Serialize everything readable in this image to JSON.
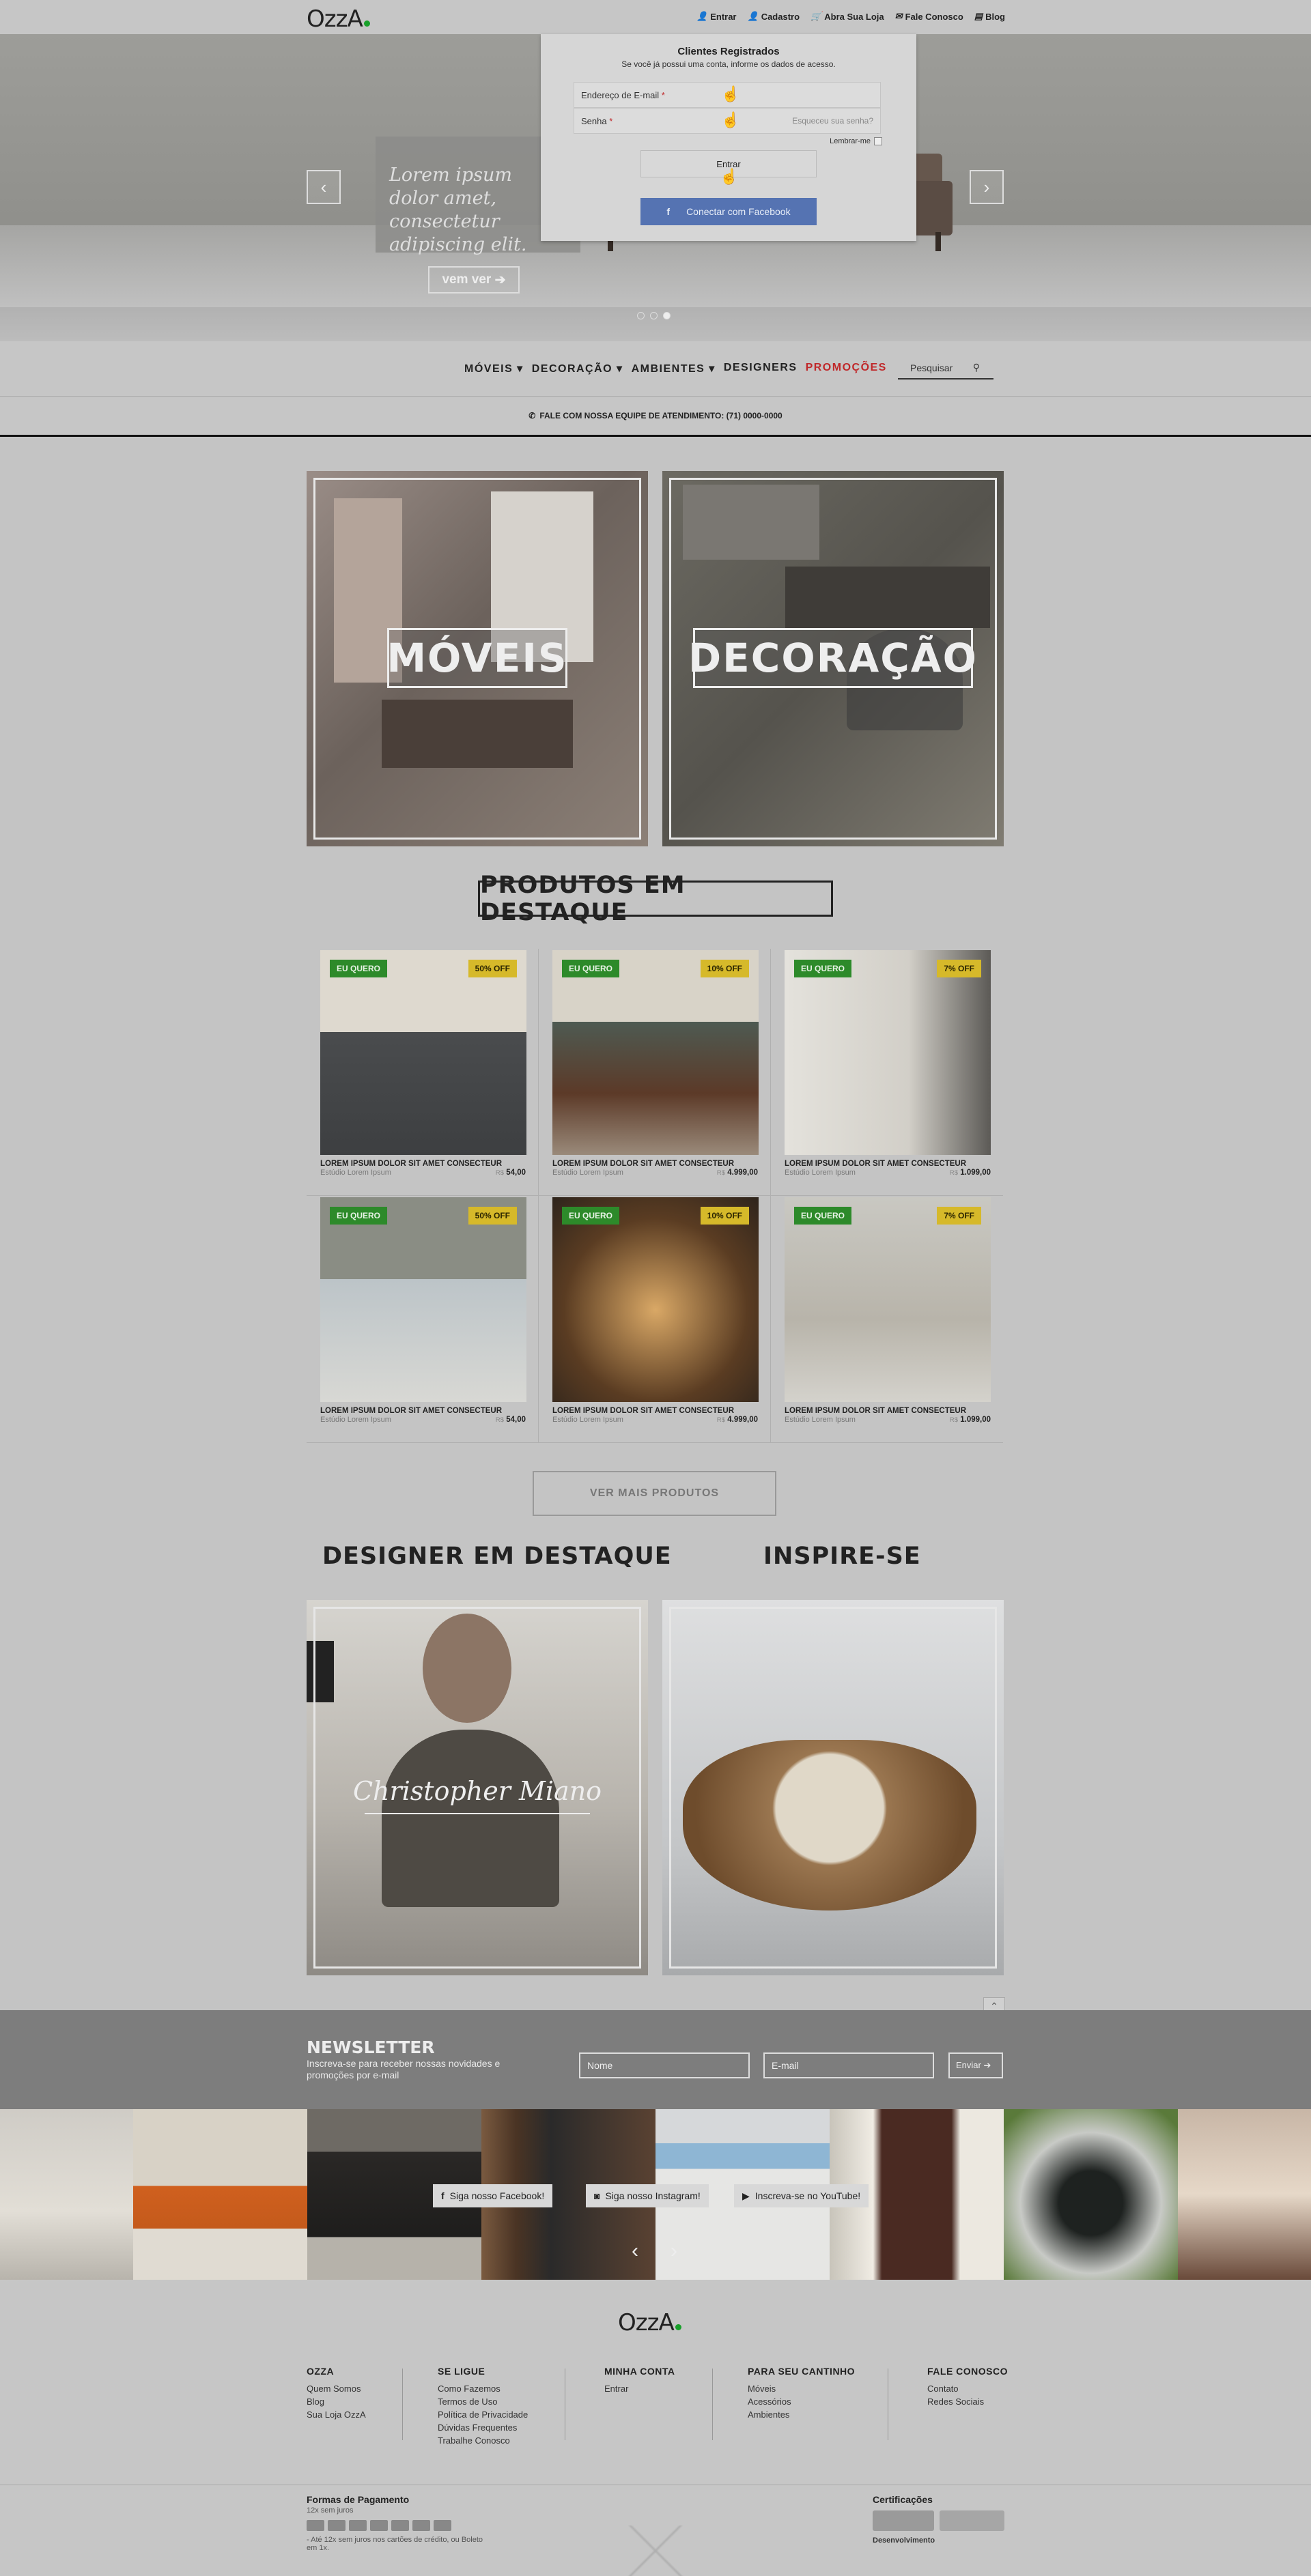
{
  "header": {
    "logo": "OzzA",
    "links": [
      "Entrar",
      "Cadastro",
      "Abra Sua Loja",
      "Fale Conosco",
      "Blog"
    ]
  },
  "hero": {
    "text": "Lorem ipsum dolor amet, consectetur adipiscing elit.",
    "button": "vem ver",
    "prev": "‹",
    "next": "›"
  },
  "login": {
    "title": "Clientes Registrados",
    "subtitle": "Se você já possui uma conta, informe os dados de acesso.",
    "email_label": "Endereço de E-mail",
    "password_label": "Senha",
    "required": "*",
    "forgot": "Esqueceu sua senha?",
    "remember": "Lembrar-me",
    "submit": "Entrar",
    "facebook": "Conectar com Facebook",
    "fb_icon": "f"
  },
  "nav": {
    "items": [
      "MÓVEIS",
      "DECORAÇÃO",
      "AMBIENTES",
      "DESIGNERS"
    ],
    "promo": "PROMOÇÕES",
    "search": "Pesquisar",
    "phone": "FALE COM NOSSA EQUIPE DE ATENDIMENTO: (71) 0000-0000"
  },
  "categories": [
    "MÓVEIS",
    "DECORAÇÃO"
  ],
  "featured": {
    "title": "PRODUTOS EM DESTAQUE",
    "want": "EU QUERO",
    "currency": "R$",
    "products": [
      {
        "off": "50% OFF",
        "name": "LOREM IPSUM DOLOR SIT AMET CONSECTEUR",
        "studio": "Estúdio Lorem Ipsum",
        "price": "54,00"
      },
      {
        "off": "10% OFF",
        "name": "LOREM IPSUM DOLOR SIT AMET CONSECTEUR",
        "studio": "Estúdio Lorem Ipsum",
        "price": "4.999,00"
      },
      {
        "off": "7% OFF",
        "name": "LOREM IPSUM DOLOR SIT AMET CONSECTEUR",
        "studio": "Estúdio Lorem Ipsum",
        "price": "1.099,00"
      },
      {
        "off": "50% OFF",
        "name": "LOREM IPSUM DOLOR SIT AMET CONSECTEUR",
        "studio": "Estúdio Lorem Ipsum",
        "price": "54,00"
      },
      {
        "off": "10% OFF",
        "name": "LOREM IPSUM DOLOR SIT AMET CONSECTEUR",
        "studio": "Estúdio Lorem Ipsum",
        "price": "4.999,00"
      },
      {
        "off": "7% OFF",
        "name": "LOREM IPSUM DOLOR SIT AMET CONSECTEUR",
        "studio": "Estúdio Lorem Ipsum",
        "price": "1.099,00"
      }
    ],
    "more": "VER MAIS PRODUTOS"
  },
  "designer": {
    "title": "DESIGNER EM DESTAQUE",
    "name": "Christopher Miano"
  },
  "inspire": {
    "title": "INSPIRE-SE"
  },
  "newsletter": {
    "title": "NEWSLETTER",
    "text": "Inscreva-se para receber nossas novidades e promoções por e-mail",
    "name_ph": "Nome",
    "email_ph": "E-mail",
    "submit": "Enviar ➔",
    "top": "topo"
  },
  "social": [
    "Siga nosso Facebook!",
    "Siga nosso Instagram!",
    "Inscreva-se no YouTube!"
  ],
  "footer": {
    "logo": "OzzA",
    "cols": [
      {
        "title": "OZZA",
        "links": [
          "Quem Somos",
          "Blog",
          "Sua Loja OzzA"
        ]
      },
      {
        "title": "SE LIGUE",
        "links": [
          "Como Fazemos",
          "Termos de Uso",
          "Política de Privacidade",
          "Dúvidas Frequentes",
          "Trabalhe Conosco"
        ]
      },
      {
        "title": "MINHA CONTA",
        "links": [
          "Entrar"
        ]
      },
      {
        "title": "PARA SEU CANTINHO",
        "links": [
          "Móveis",
          "Acessórios",
          "Ambientes"
        ]
      },
      {
        "title": "FALE CONOSCO",
        "links": [
          "Contato",
          "Redes Sociais"
        ]
      }
    ],
    "payment_title": "Formas de Pagamento",
    "payment_sub": "12x sem juros",
    "payment_note": "- Até 12x sem juros nos cartões de crédito, ou Boleto em 1x.",
    "cert_title": "Certificações",
    "dev": "Desenvolvimento"
  },
  "colors": {
    "accent_green": "#2d8a2a",
    "promo_red": "#c0282a",
    "facebook": "#5573b2",
    "tag_yellow": "#d6b92a"
  }
}
